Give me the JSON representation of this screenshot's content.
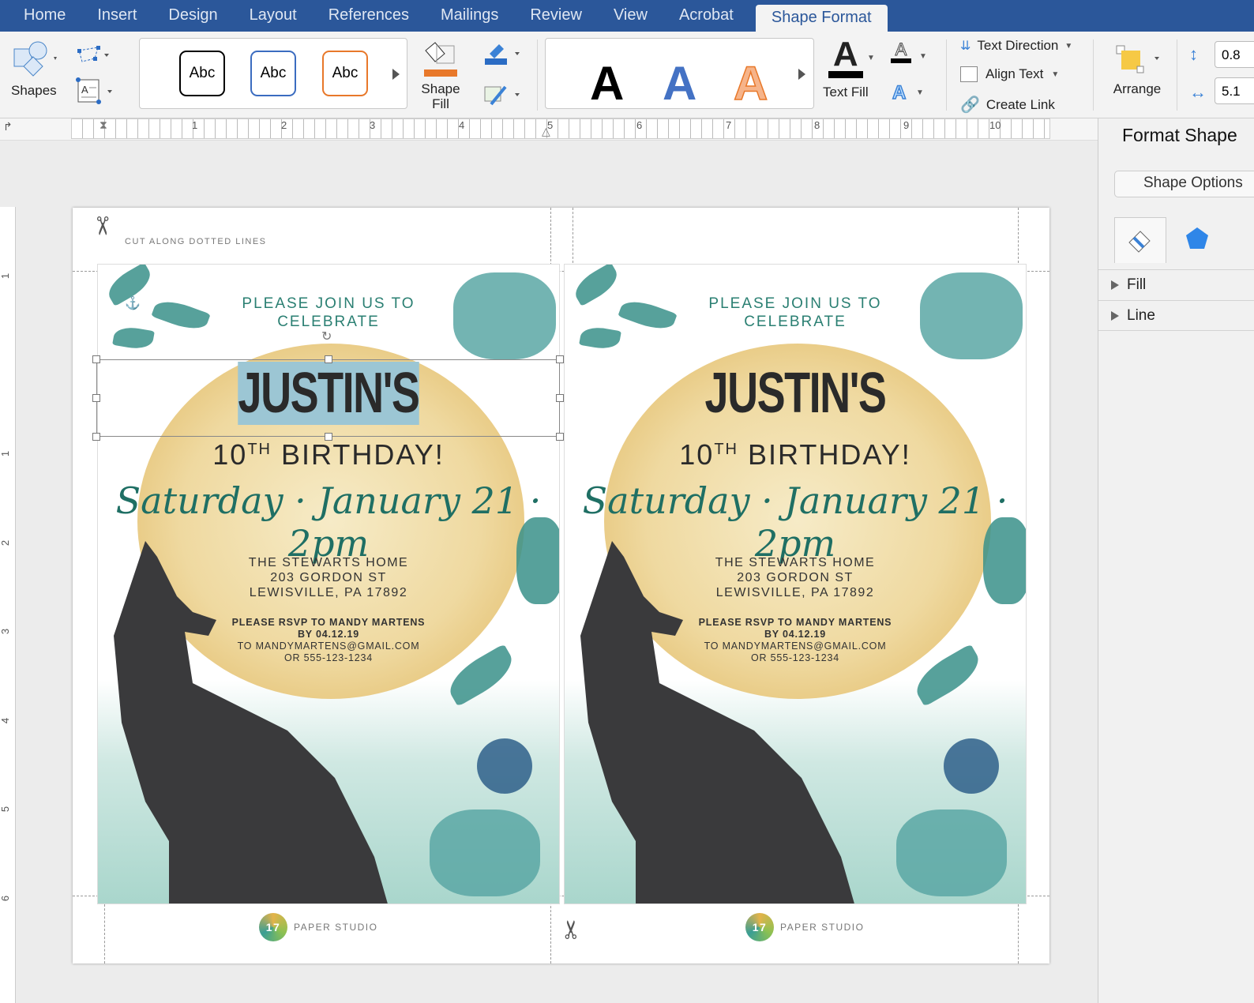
{
  "tabs": [
    "Home",
    "Insert",
    "Design",
    "Layout",
    "References",
    "Mailings",
    "Review",
    "View",
    "Acrobat",
    "Shape Format"
  ],
  "ribbon": {
    "shapes": "Shapes",
    "style_sample": "Abc",
    "shape_fill_1": "Shape",
    "shape_fill_2": "Fill",
    "wordart_letter": "A",
    "text_fill": "Text Fill",
    "text_direction": "Text Direction",
    "align_text": "Align Text",
    "create_link": "Create Link",
    "arrange": "Arrange",
    "height_value": "0.8",
    "width_value": "5.1"
  },
  "ruler": [
    "1",
    "2",
    "3",
    "4",
    "5",
    "6",
    "7",
    "8",
    "9",
    "10"
  ],
  "vruler": [
    "1",
    "1",
    "2",
    "3",
    "4",
    "5",
    "6"
  ],
  "page": {
    "cut_label": "CUT ALONG DOTTED LINES",
    "footer": "PAPER STUDIO",
    "logo": "17"
  },
  "card": {
    "join": "PLEASE JOIN US TO",
    "celebrate": "CELEBRATE",
    "name": "JUSTIN'S",
    "bday_num": "10",
    "bday_sup": "TH",
    "bday_word": "BIRTHDAY!",
    "date": "Saturday · January 21 · 2pm",
    "addr1": "THE STEWARTS HOME",
    "addr2": "203 GORDON ST",
    "addr3": "LEWISVILLE, PA 17892",
    "rsvp1": "PLEASE RSVP TO MANDY MARTENS",
    "rsvp2": "BY 04.12.19",
    "rsvp3": "TO MANDYMARTENS@GMAIL.COM",
    "rsvp4": "OR 555-123-1234"
  },
  "panel": {
    "title": "Format Shape",
    "options_button": "Shape Options",
    "fill": "Fill",
    "line": "Line"
  },
  "colors": {
    "tabbar": "#2b579a",
    "teal": "#2a7f72",
    "moon": "#efd9a0"
  }
}
